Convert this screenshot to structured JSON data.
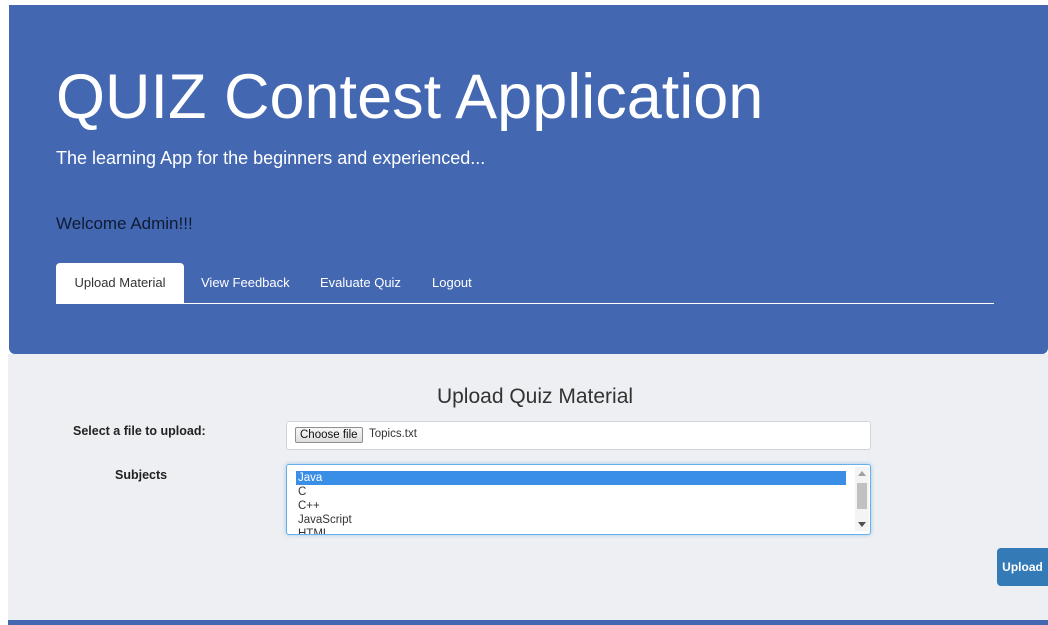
{
  "header": {
    "title": "QUIZ Contest Application",
    "subtitle": "The learning App for the beginners and experienced...",
    "welcome": "Welcome Admin!!!"
  },
  "nav": {
    "tabs": [
      {
        "label": "Upload Material",
        "active": true
      },
      {
        "label": "View Feedback",
        "active": false
      },
      {
        "label": "Evaluate Quiz",
        "active": false
      },
      {
        "label": "Logout",
        "active": false
      }
    ]
  },
  "form": {
    "section_title": "Upload Quiz Material",
    "file_label": "Select a file to upload:",
    "choose_button": "Choose file",
    "file_name": "Topics.txt",
    "subjects_label": "Subjects",
    "subjects": [
      "Java",
      "C",
      "C++",
      "JavaScript",
      "HTML"
    ],
    "selected_subject": "Java",
    "upload_button": "Upload"
  },
  "colors": {
    "header_bg": "#4367b1",
    "content_bg": "#eeeff2",
    "selected_option": "#3a8ee6",
    "upload_button": "#337ab7"
  }
}
